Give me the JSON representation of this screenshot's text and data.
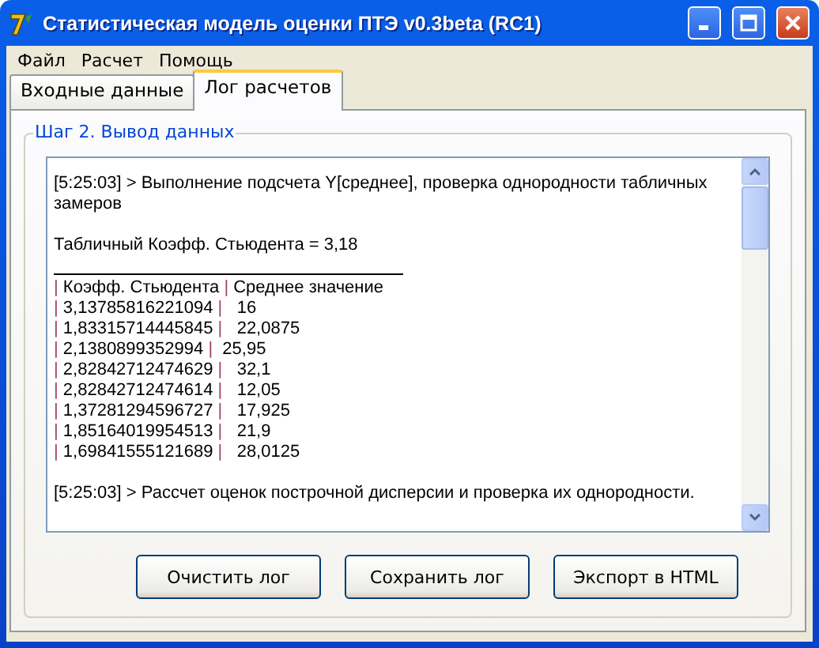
{
  "window": {
    "title": "Статистическая модель оценки ПТЭ v0.3beta (RC1)"
  },
  "menu": [
    "Файл",
    "Расчет",
    "Помощь"
  ],
  "tabs": [
    {
      "label": "Входные данные",
      "selected": false
    },
    {
      "label": "Лог расчетов",
      "selected": true
    }
  ],
  "group": {
    "title": "Шаг 2. Вывод данных"
  },
  "log": [
    {
      "kind": "text",
      "text": "[5:25:03] > Выполнение подсчета Y[среднее], проверка однородности табличных замеров"
    },
    {
      "kind": "blank"
    },
    {
      "kind": "text",
      "text": "Табличный Коэфф. Стьюдента = 3,18"
    },
    {
      "kind": "rule"
    },
    {
      "kind": "row",
      "text": "| Коэфф. Стьюдента | Среднее значение"
    },
    {
      "kind": "row",
      "text": "| 3,13785816221094 |   16"
    },
    {
      "kind": "row",
      "text": "| 1,83315714445845 |   22,0875"
    },
    {
      "kind": "row",
      "text": "| 2,1380899352994 |  25,95"
    },
    {
      "kind": "row",
      "text": "| 2,82842712474629 |   32,1"
    },
    {
      "kind": "row",
      "text": "| 2,82842712474614 |   12,05"
    },
    {
      "kind": "row",
      "text": "| 1,37281294596727 |   17,925"
    },
    {
      "kind": "row",
      "text": "| 1,85164019954513 |   21,9"
    },
    {
      "kind": "row",
      "text": "| 1,69841555121689 |   28,0125"
    },
    {
      "kind": "blank"
    },
    {
      "kind": "text",
      "text": "[5:25:03] > Рассчет оценок построчной дисперсии и проверка их однородности."
    }
  ],
  "buttons": [
    "Очистить лог",
    "Сохранить лог",
    "Экспорт в HTML"
  ]
}
